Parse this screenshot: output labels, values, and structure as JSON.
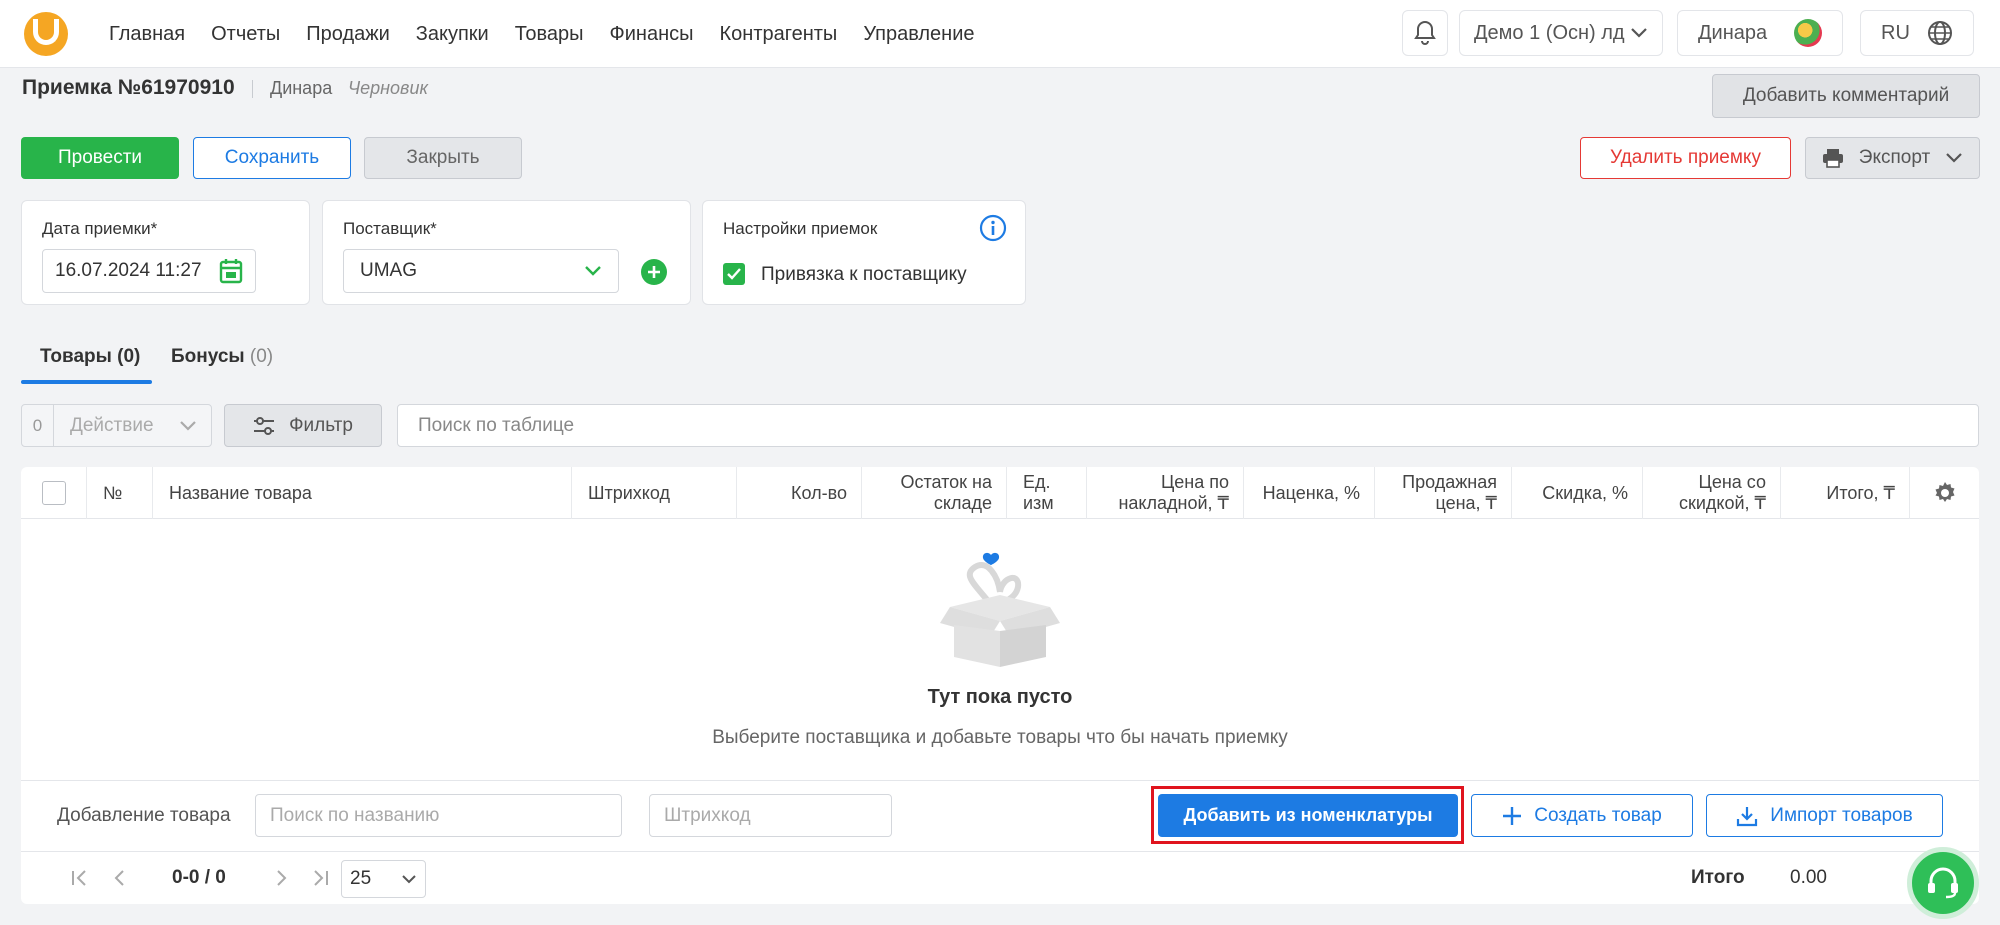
{
  "nav": {
    "items": [
      "Главная",
      "Отчеты",
      "Продажи",
      "Закупки",
      "Товары",
      "Финансы",
      "Контрагенты",
      "Управление"
    ],
    "store": "Демо 1 (Осн) лд",
    "user": "Динара",
    "lang": "RU"
  },
  "header": {
    "title": "Приемка №61970910",
    "author": "Динара",
    "status": "Черновик",
    "add_comment": "Добавить комментарий"
  },
  "actions": {
    "post": "Провести",
    "save": "Сохранить",
    "close": "Закрыть",
    "delete": "Удалить приемку",
    "export": "Экспорт"
  },
  "form": {
    "date_label": "Дата приемки*",
    "date_value": "16.07.2024 11:27",
    "supplier_label": "Поставщик*",
    "supplier_value": "UMAG",
    "settings_label": "Настройки приемок",
    "bind_label": "Привязка к поставщику",
    "bind_checked": true
  },
  "tabs": [
    {
      "label": "Товары",
      "count": "(0)"
    },
    {
      "label": "Бонусы",
      "count": "(0)"
    }
  ],
  "toolbar": {
    "selected": "0",
    "action": "Действие",
    "filter": "Фильтр",
    "search_placeholder": "Поиск по таблице"
  },
  "table": {
    "columns": [
      "№",
      "Название товара",
      "Штрихкод",
      "Кол-во",
      "Остаток на складе",
      "Ед. изм",
      "Цена по накладной, ₸",
      "Наценка, %",
      "Продажная цена, ₸",
      "Скидка, %",
      "Цена со скидкой, ₸",
      "Итого, ₸"
    ],
    "empty_title": "Тут пока пусто",
    "empty_subtitle": "Выберите поставщика и добавьте товары что бы начать приемку"
  },
  "add": {
    "label": "Добавление товара",
    "name_placeholder": "Поиск по названию",
    "barcode_placeholder": "Штрихкод",
    "from_nomenclature": "Добавить из номенклатуры",
    "create": "Создать товар",
    "import": "Импорт товаров"
  },
  "pagination": {
    "range": "0-0 / 0",
    "page_size": "25",
    "total_label": "Итого",
    "total_value": "0.00"
  },
  "colors": {
    "accent": "#1d7be3",
    "success": "#28b44a",
    "danger": "#e53935",
    "highlight": "#e0141e"
  }
}
